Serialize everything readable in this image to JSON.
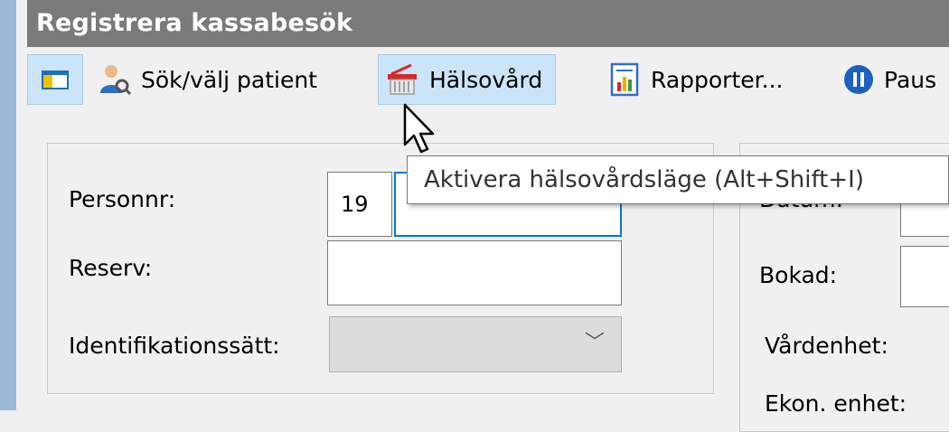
{
  "window": {
    "title": "Registrera kassabesök"
  },
  "toolbar": {
    "layout_icon": "layout-icon",
    "search_patient": {
      "label": "Sök/välj patient",
      "icon": "patient-search-icon"
    },
    "healthcare": {
      "label": "Hälsovård",
      "icon": "healthcare-basket-icon"
    },
    "reports": {
      "label": "Rapporter...",
      "icon": "report-icon"
    },
    "pause": {
      "label": "Paus",
      "icon": "pause-icon"
    }
  },
  "tooltip": {
    "text": "Aktivera hälsovårdsläge (Alt+Shift+I)"
  },
  "form_left": {
    "personnr_label": "Personnr:",
    "personnr_century": "19",
    "personnr_value": "",
    "reserv_label": "Reserv:",
    "identifikation_label": "Identifikationssätt:",
    "identifikation_value": ""
  },
  "form_right": {
    "datum_label": "Datum:",
    "bokad_label": "Bokad:",
    "vardenhet_label": "Vårdenhet:",
    "ekon_enhet_label": "Ekon. enhet:"
  },
  "colors": {
    "titlebar": "#7a7a7a",
    "toolbar_selected": "#cce4f7",
    "focus_border": "#0078d7"
  }
}
